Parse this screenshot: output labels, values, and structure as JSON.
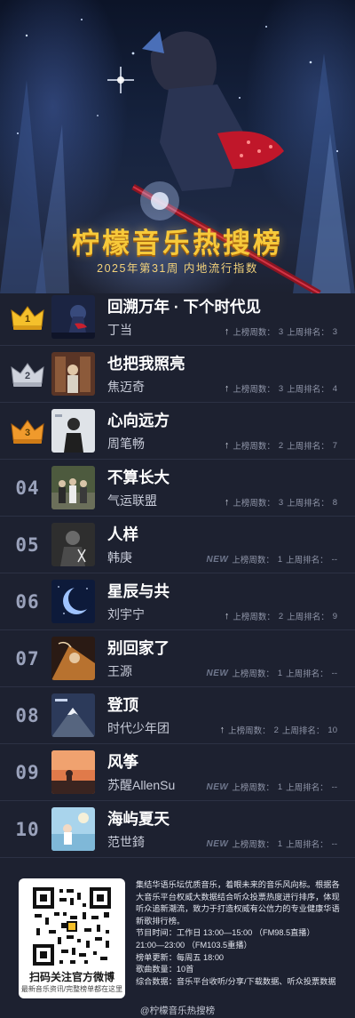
{
  "header": {
    "title": "柠檬音乐热搜榜",
    "subtitle": "2025年第31周 内地流行指数"
  },
  "labels": {
    "weeks_prefix": "上榜周数：",
    "last_rank_prefix": "上周排名：",
    "new_tag": "NEW"
  },
  "colors": {
    "background": "#1d2130",
    "title_gold": "#f7c93a",
    "crown_gold": "#f5c02b",
    "crown_silver": "#cfd3dd",
    "crown_bronze": "#f09a2c"
  },
  "chart": [
    {
      "rank": "1",
      "song": "回溯万年 · 下个时代见",
      "artist": "丁当",
      "trend": "up",
      "weeks": "3",
      "last_rank": "3",
      "crown": "gold"
    },
    {
      "rank": "2",
      "song": "也把我照亮",
      "artist": "焦迈奇",
      "trend": "up",
      "weeks": "3",
      "last_rank": "4",
      "crown": "silver"
    },
    {
      "rank": "3",
      "song": "心向远方",
      "artist": "周笔畅",
      "trend": "up",
      "weeks": "2",
      "last_rank": "7",
      "crown": "bronze"
    },
    {
      "rank": "04",
      "song": "不算长大",
      "artist": "气运联盟",
      "trend": "up",
      "weeks": "3",
      "last_rank": "8"
    },
    {
      "rank": "05",
      "song": "人样",
      "artist": "韩庚",
      "trend": "new",
      "weeks": "1",
      "last_rank": "--"
    },
    {
      "rank": "06",
      "song": "星辰与共",
      "artist": "刘宇宁",
      "trend": "up",
      "weeks": "2",
      "last_rank": "9"
    },
    {
      "rank": "07",
      "song": "别回家了",
      "artist": "王源",
      "trend": "new",
      "weeks": "1",
      "last_rank": "--"
    },
    {
      "rank": "08",
      "song": "登顶",
      "artist": "时代少年团",
      "trend": "up",
      "weeks": "2",
      "last_rank": "10"
    },
    {
      "rank": "09",
      "song": "风筝",
      "artist": "苏醒AllenSu",
      "trend": "new",
      "weeks": "1",
      "last_rank": "--"
    },
    {
      "rank": "10",
      "song": "海屿夏天",
      "artist": "范世錡",
      "trend": "new",
      "weeks": "1",
      "last_rank": "--"
    }
  ],
  "footer": {
    "qr_caption": "扫码关注官方微博",
    "qr_subcaption": "最新音乐资讯/完整榜单都在这里",
    "description": "集结华语乐坛优质音乐，着眼未来的音乐风向标。根据各大音乐平台权威大数据结合听众投票热度进行排序，体现听众追新潮流，致力于打造权威有公信力的专业健康华语新歌排行榜。",
    "schedule_1": "节目时间：工作日 13:00—15:00 （FM98.5直播）",
    "schedule_2": "21:00—23:00 （FM103.5重播）",
    "update": "榜单更新：每周五 18:00",
    "count": "歌曲数量：10首",
    "sources": "综合数据：音乐平台收听/分享/下载数据、听众投票数据",
    "weibo": "@柠檬音乐热搜榜"
  }
}
